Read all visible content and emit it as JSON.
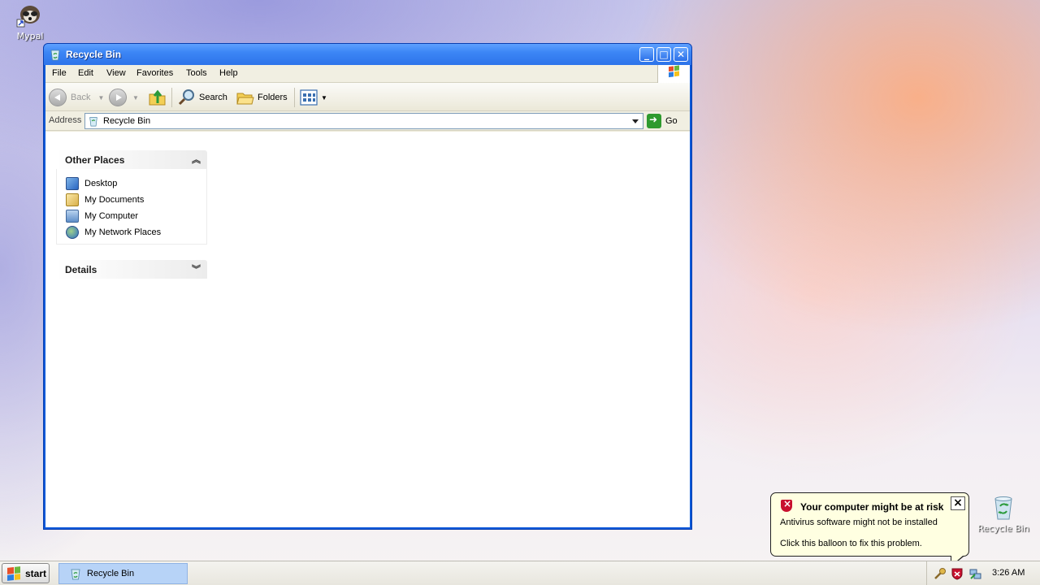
{
  "desktop": {
    "mypal_label": "Mypal",
    "recycle_label": "Recycle Bin"
  },
  "window": {
    "title": "Recycle Bin",
    "menu": [
      "File",
      "Edit",
      "View",
      "Favorites",
      "Tools",
      "Help"
    ],
    "toolbar": {
      "back_label": "Back",
      "search_label": "Search",
      "folders_label": "Folders"
    },
    "address": {
      "label": "Address",
      "value": "Recycle Bin",
      "go_label": "Go"
    },
    "other_places": {
      "title": "Other Places",
      "items": [
        "Desktop",
        "My Documents",
        "My Computer",
        "My Network Places"
      ]
    },
    "details": {
      "title": "Details"
    }
  },
  "taskbar": {
    "start_label": "start",
    "task_label": "Recycle Bin",
    "clock": "3:26 AM"
  },
  "balloon": {
    "title": "Your computer might be at risk",
    "line1": "Antivirus software might not be installed",
    "line2": "Click this balloon to fix this problem."
  },
  "colors": {
    "title_bar": "#2d73ea",
    "selected_task": "#b7d3f7",
    "balloon_bg": "#ffffe1",
    "shield_red": "#c8102e"
  }
}
